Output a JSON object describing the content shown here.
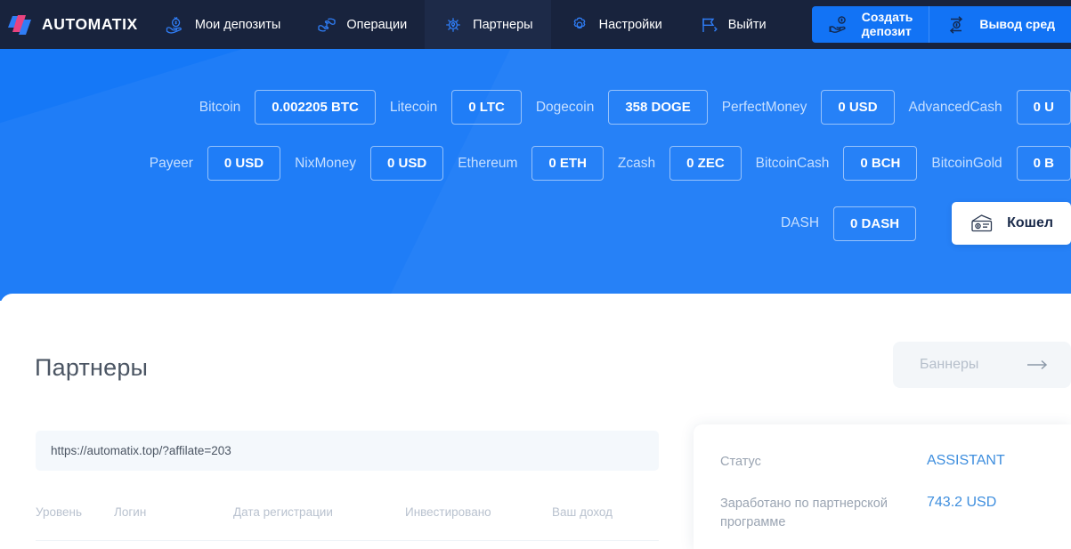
{
  "header": {
    "logo_icon": "automatix-logo-icon",
    "brand": "AUTOMATIX",
    "nav": [
      {
        "label": "Мои депозиты",
        "icon": "hand-money-bag-icon",
        "active": false
      },
      {
        "label": "Операции",
        "icon": "money-exchange-icon",
        "active": false
      },
      {
        "label": "Партнеры",
        "icon": "network-users-icon",
        "active": true
      },
      {
        "label": "Настройки",
        "icon": "gear-icon",
        "active": false
      },
      {
        "label": "Выйти",
        "icon": "flag-exit-icon",
        "active": false
      }
    ],
    "cta": [
      {
        "label_line1": "Создать",
        "label_line2": "депозит",
        "icon": "hand-coin-icon"
      },
      {
        "label_line1": "Вывод сред",
        "label_line2": "",
        "icon": "withdraw-arrows-icon"
      }
    ]
  },
  "balances": {
    "rows": [
      [
        {
          "name": "Bitcoin",
          "value": "0.002205 BTC"
        },
        {
          "name": "Litecoin",
          "value": "0 LTC"
        },
        {
          "name": "Dogecoin",
          "value": "358 DOGE"
        },
        {
          "name": "PerfectMoney",
          "value": "0 USD"
        },
        {
          "name": "AdvancedCash",
          "value": "0 U"
        }
      ],
      [
        {
          "name": "Payeer",
          "value": "0 USD"
        },
        {
          "name": "NixMoney",
          "value": "0 USD"
        },
        {
          "name": "Ethereum",
          "value": "0 ETH"
        },
        {
          "name": "Zcash",
          "value": "0 ZEC"
        },
        {
          "name": "BitcoinCash",
          "value": "0 BCH"
        },
        {
          "name": "BitcoinGold",
          "value": "0 B"
        }
      ],
      [
        {
          "name": "DASH",
          "value": "0 DASH"
        }
      ]
    ],
    "wallet_button": {
      "label": "Кошел",
      "icon": "wallet-cash-icon"
    }
  },
  "main": {
    "title": "Партнеры",
    "banners_button": {
      "label": "Баннеры",
      "icon": "arrow-right-icon"
    },
    "referral_link": "https://automatix.top/?affilate=203",
    "table": {
      "columns": [
        "Уровень",
        "Логин",
        "Дата регистрации",
        "Инвестировано",
        "Ваш доход"
      ]
    }
  },
  "side_panel": {
    "rows": [
      {
        "label": "Статус",
        "value": "ASSISTANT"
      },
      {
        "label": "Заработано по партнерской программе",
        "value": "743.2 USD"
      }
    ]
  },
  "colors": {
    "nav_bg": "#18233d",
    "banner_blue": "#1578f7",
    "cta_blue": "#1273f5",
    "accent_link": "#3e8ede",
    "muted_text": "#b9c2cf"
  }
}
